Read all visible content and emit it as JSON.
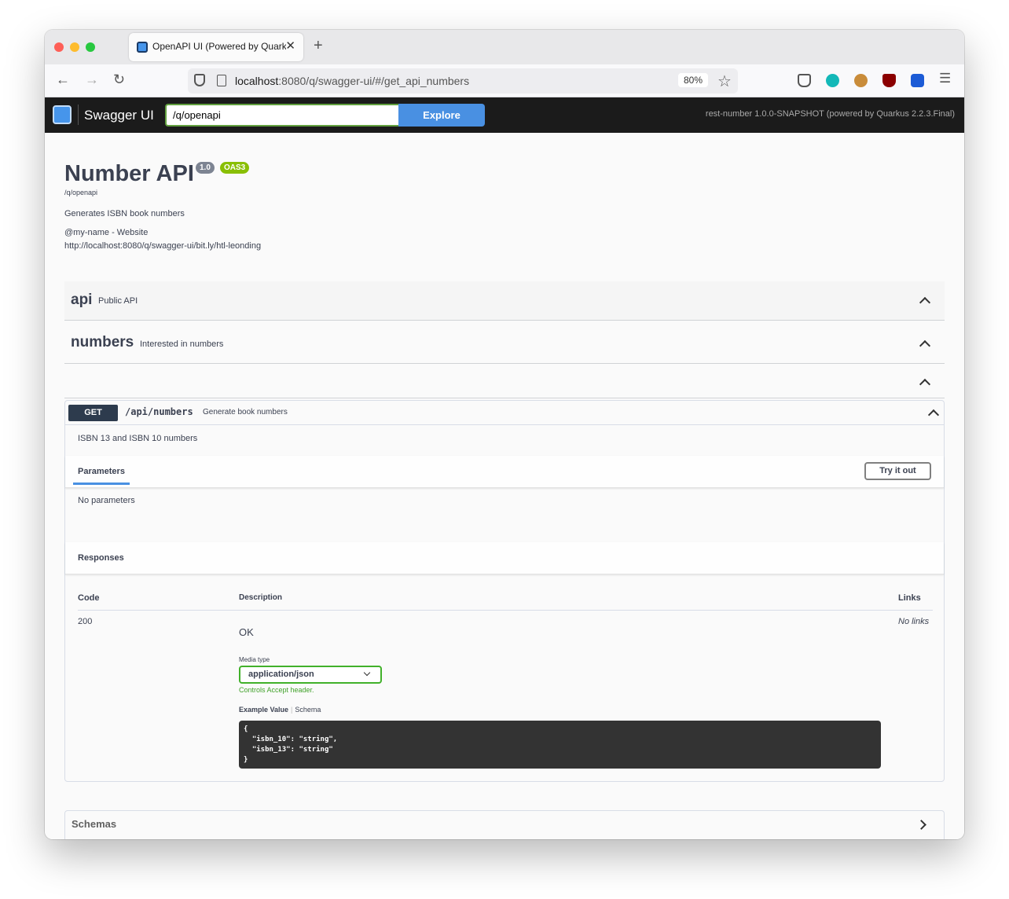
{
  "browser": {
    "tab_title": "OpenAPI UI (Powered by Quarkus",
    "url_host": "localhost",
    "url_rest": ":8080/q/swagger-ui/#/get_api_numbers",
    "zoom": "80%"
  },
  "topbar": {
    "brand": "Swagger UI",
    "spec_url": "/q/openapi",
    "explore_label": "Explore",
    "version_info": "rest-number 1.0.0-SNAPSHOT (powered by Quarkus 2.2.3.Final)"
  },
  "info": {
    "title": "Number API",
    "version_badge": "1.0",
    "oas_badge": "OAS3",
    "spec_link": "/q/openapi",
    "description": "Generates ISBN book numbers",
    "contact": "@my-name - Website",
    "link": "http://localhost:8080/q/swagger-ui/bit.ly/htl-leonding"
  },
  "tags": [
    {
      "name": "api",
      "description": "Public API"
    },
    {
      "name": "numbers",
      "description": "Interested in numbers"
    }
  ],
  "operation": {
    "method": "GET",
    "path": "/api/numbers",
    "summary": "Generate book numbers",
    "description": "ISBN 13 and ISBN 10 numbers",
    "params_tab": "Parameters",
    "try_label": "Try it out",
    "no_params": "No parameters",
    "responses_title": "Responses",
    "headers": {
      "code": "Code",
      "description": "Description",
      "links": "Links"
    },
    "response": {
      "code": "200",
      "description": "OK",
      "links": "No links",
      "media_label": "Media type",
      "media_value": "application/json",
      "media_hint": "Controls Accept header.",
      "example_tab": "Example Value",
      "schema_tab": "Schema",
      "example": "{\n  \"isbn_10\": \"string\",\n  \"isbn_13\": \"string\"\n}"
    }
  },
  "schemas_title": "Schemas",
  "colors": {
    "topbar": "#1b1b1b",
    "explore": "#4990e2",
    "get_method": "#2d3b4d",
    "oas_badge": "#89bf04",
    "media_border": "#41b12a"
  }
}
